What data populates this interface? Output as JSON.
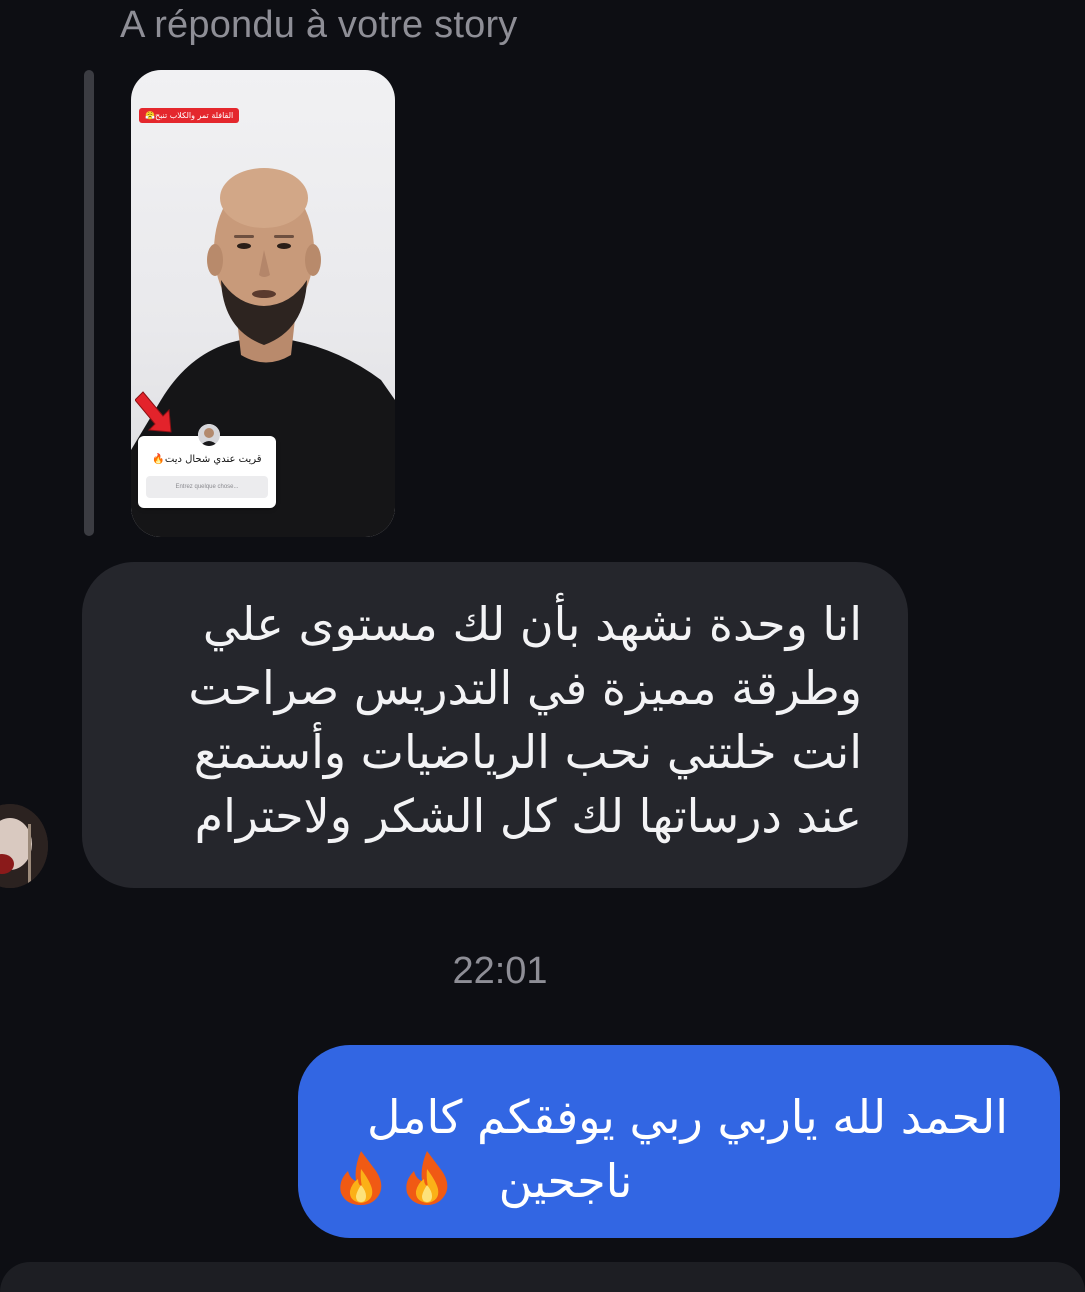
{
  "story_reply": {
    "header": "A répondu à votre story",
    "banner_text": "القافلة تمر والكلاب تنبح😤",
    "question_text": "قريت عندي شحال ديت🔥",
    "question_placeholder": "Entrez quelque chose..."
  },
  "messages": [
    {
      "direction": "incoming",
      "lines": [
        "انا وحدة نشهد بأن لك مستوى علي",
        "وطرقة مميزة في التدريس صراحت",
        "انت خلتني نحب الرياضيات وأستمتع",
        "عند درساتها لك كل الشكر ولاحترام"
      ]
    },
    {
      "direction": "outgoing",
      "line1": "الحمد لله ياربي ربي يوفقكم كامل",
      "line2": "ناجحين",
      "emoji": "fire-emoji",
      "emoji_count": 2
    }
  ],
  "timestamp": "22:01",
  "colors": {
    "background": "#0d0e13",
    "incoming_bubble": "#25262c",
    "outgoing_bubble": "#3266e3",
    "secondary_text": "#8e8e96"
  }
}
